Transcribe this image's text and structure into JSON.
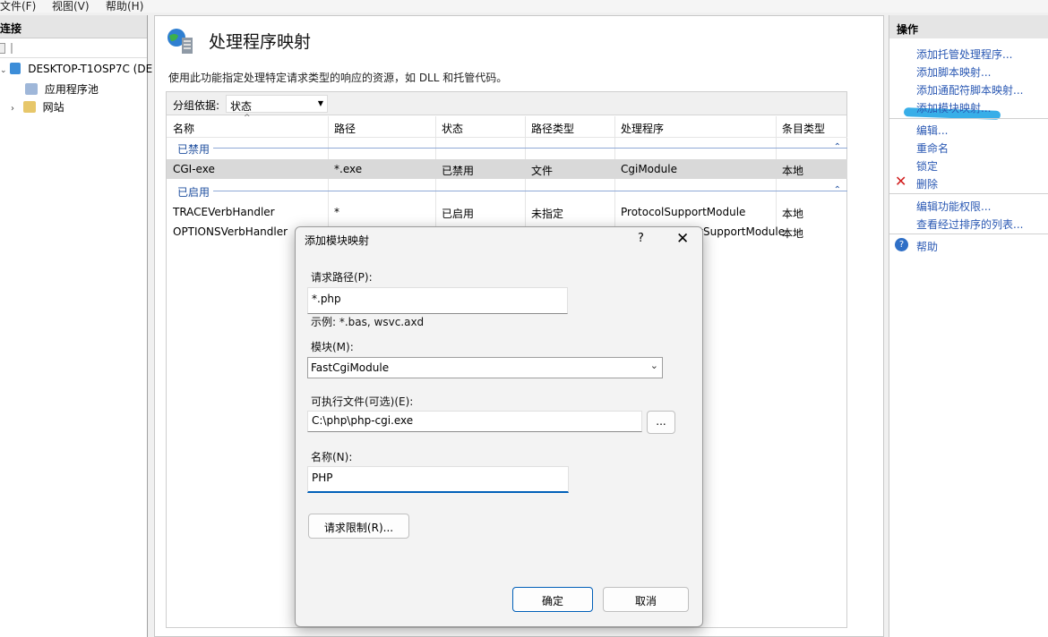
{
  "menubar": {
    "file": "文件(F)",
    "view": "视图(V)",
    "help": "帮助(H)"
  },
  "connections": {
    "header": "连接",
    "server": "DESKTOP-T1OSP7C (DE",
    "app_pools": "应用程序池",
    "sites": "网站"
  },
  "page": {
    "title": "处理程序映射",
    "description": "使用此功能指定处理特定请求类型的响应的资源，如 DLL 和托管代码。",
    "group_by_label": "分组依据:",
    "group_by_value": "状态",
    "columns": [
      "名称",
      "路径",
      "状态",
      "路径类型",
      "处理程序",
      "条目类型"
    ],
    "group_disabled": "已禁用",
    "group_enabled": "已启用",
    "rows_disabled": [
      {
        "name": "CGI-exe",
        "path": "*.exe",
        "state": "已禁用",
        "path_type": "文件",
        "handler": "CgiModule",
        "entry_type": "本地"
      }
    ],
    "rows_enabled": [
      {
        "name": "TRACEVerbHandler",
        "path": "*",
        "state": "已启用",
        "path_type": "未指定",
        "handler": "ProtocolSupportModule",
        "entry_type": "本地"
      },
      {
        "name": "OPTIONSVerbHandler",
        "path": "",
        "state": "",
        "path_type": "",
        "handler": "otSupportModule",
        "entry_type": "本地"
      }
    ]
  },
  "actions": {
    "header": "操作",
    "items": [
      "添加托管处理程序...",
      "添加脚本映射...",
      "添加通配符脚本映射...",
      "添加模块映射...",
      "编辑...",
      "重命名",
      "锁定",
      "删除",
      "编辑功能权限...",
      "查看经过排序的列表...",
      "帮助"
    ]
  },
  "dialog": {
    "title": "添加模块映射",
    "help": "?",
    "close": "✕",
    "request_path_label": "请求路径(P):",
    "request_path_value": "*.php",
    "example": "示例: *.bas, wsvc.axd",
    "module_label": "模块(M):",
    "module_value": "FastCgiModule",
    "executable_label": "可执行文件(可选)(E):",
    "executable_value": "C:\\php\\php-cgi.exe",
    "browse": "...",
    "name_label": "名称(N):",
    "name_value": "PHP",
    "restrictions_button": "请求限制(R)...",
    "ok_button": "确定",
    "cancel_button": "取消"
  }
}
